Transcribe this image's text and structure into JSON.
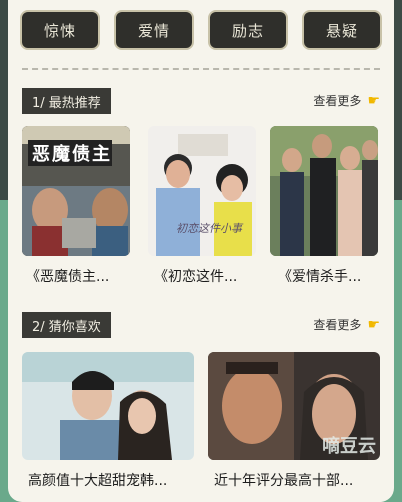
{
  "genres": [
    "惊悚",
    "爱情",
    "励志",
    "悬疑"
  ],
  "hot": {
    "label": "1/  最热推荐",
    "more": "查看更多",
    "items": [
      {
        "caption": "《恶魔债主...",
        "poster_title": "恶魔债主"
      },
      {
        "caption": "《初恋这件...",
        "poster_title": "初恋这件小事"
      },
      {
        "caption": "《爱情杀手..."
      }
    ]
  },
  "guess": {
    "label": "2/  猜你喜欢",
    "more": "查看更多",
    "items": [
      {
        "caption": "高颜值十大超甜宠韩..."
      },
      {
        "caption": "近十年评分最高十部..."
      }
    ]
  },
  "watermark": "嘀豆云"
}
